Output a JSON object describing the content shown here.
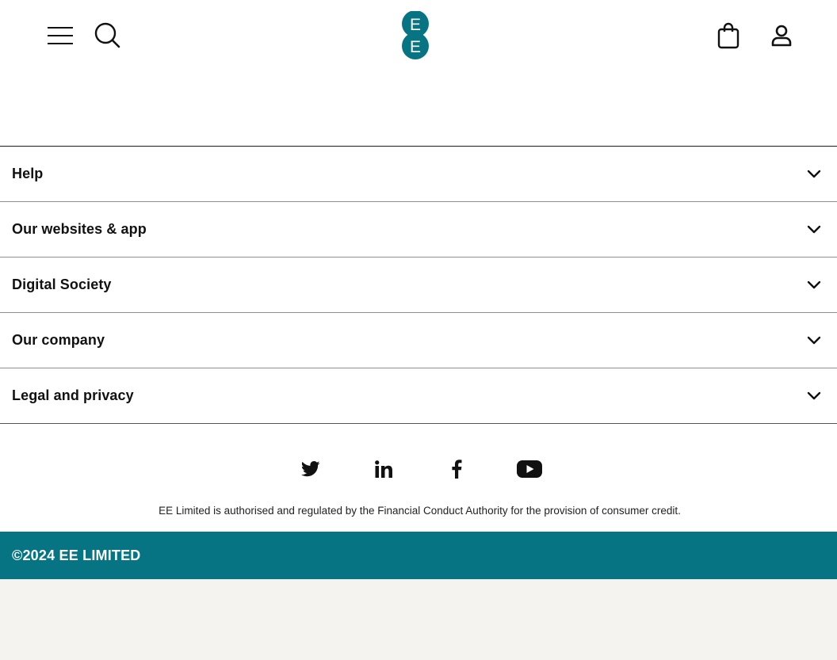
{
  "colors": {
    "brand_teal": "#067482",
    "page_background": "#f4f3f0",
    "text": "#111111"
  },
  "header": {
    "menu_icon": "hamburger-menu-icon",
    "search_icon": "search-icon",
    "logo_text": [
      "E",
      "E"
    ],
    "basket_icon": "shopping-bag-icon",
    "account_icon": "user-account-icon"
  },
  "footer": {
    "accordion": [
      {
        "label": "Help"
      },
      {
        "label": "Our websites & app"
      },
      {
        "label": "Digital Society"
      },
      {
        "label": "Our company"
      },
      {
        "label": "Legal and privacy"
      }
    ],
    "social": [
      {
        "icon": "twitter-icon"
      },
      {
        "icon": "linkedin-icon"
      },
      {
        "icon": "facebook-icon"
      },
      {
        "icon": "youtube-icon"
      }
    ],
    "regulatory_text": "EE Limited is authorised and regulated by the Financial Conduct Authority for the provision of consumer credit.",
    "copyright": "©2024 EE LIMITED"
  }
}
